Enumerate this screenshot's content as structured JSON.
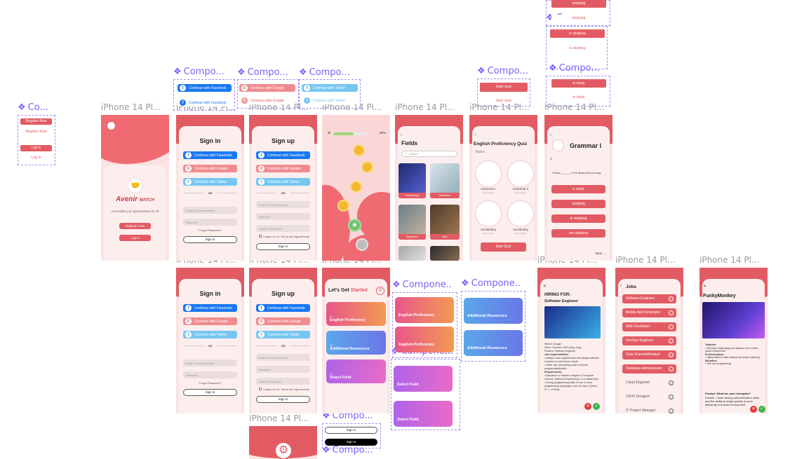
{
  "labels": {
    "iphone": "iPhone 14 Pl...",
    "component": "Compo...",
    "component_long": "Compone...",
    "co": "Co..."
  },
  "components": {
    "register_now": "Register Now",
    "log_in": "Log In",
    "continue_facebook": "Continue with Facebook",
    "continue_google": "Continue with Google",
    "continue_twitter": "Continue with Twitter",
    "start_quiz": "Start Quiz",
    "studying": "studying",
    "is_studying": "is studying",
    "is_study": "is study",
    "sign_in": "Sign in"
  },
  "landing": {
    "brand": "Avenir",
    "brand_suffix": "MATCH",
    "tagline": "Accessible job opportunities for all",
    "register_now": "Register Now",
    "log_in": "Log In"
  },
  "signin": {
    "title": "Sign in",
    "facebook": "Continue with Facebook",
    "google": "Continue with Google",
    "twitter": "Continue with Twitter",
    "or": "OR",
    "email_placeholder": "Email or mobile number",
    "password_placeholder": "Password",
    "forgot": "Forgot Password?",
    "submit": "Sign in"
  },
  "signup": {
    "title": "Sign up",
    "facebook": "Continue with Facebook",
    "google": "Continue with Google",
    "twitter": "Continue with Twitter",
    "or": "OR",
    "email_placeholder": "Email or mobile number",
    "password_placeholder": "Password",
    "confirm_placeholder": "Confirm Password",
    "terms": "I agree to our Terms and Agreements",
    "submit": "Sign in"
  },
  "progress": {
    "percent_label": "60%",
    "fill_fraction": 0.6
  },
  "fields": {
    "title": "Fields",
    "search_placeholder": "Search",
    "tiles": [
      "Technology",
      "Medicine",
      "Business",
      "Arts"
    ]
  },
  "english_quiz": {
    "title": "English Proficiency Quiz",
    "subtitle": "Topics",
    "topics": [
      {
        "name": "Grammar I",
        "sub": "10 questions"
      },
      {
        "name": "Grammar II",
        "sub": "10 questions"
      },
      {
        "name": "Vocabulary",
        "sub": "10 questions"
      },
      {
        "name": "Vocabulary",
        "sub": "10 questions"
      }
    ],
    "start": "Start Quiz"
  },
  "grammar": {
    "title": "Grammar I",
    "qnum": "1.",
    "question": "Prewa ______ in the library this morning.",
    "options": [
      "is study",
      "studying",
      "is studying",
      "am studying"
    ],
    "next": "Next →"
  },
  "started": {
    "title_a": "Let's Get",
    "title_b": "Started",
    "cards": [
      {
        "num": "01",
        "label": "English Proficiency"
      },
      {
        "num": "02",
        "label": "Additional Resources"
      },
      {
        "num": "03",
        "label": "Select Field"
      }
    ]
  },
  "comp_cards": {
    "english": "English Proficiency",
    "resources": "Additional Resources",
    "select": "Select Field"
  },
  "hiring": {
    "title": "HIRING FOR:",
    "role": "Software Engineer",
    "lines": [
      "Where: Google",
      "When: Summer 2023 (May–Aug)",
      "Position: Software Engineer",
      "Job responsibilities:",
      "Analyze user requirements and design software solutions to meet those needs",
      "Write, test, and debug code to ensure program/application",
      "Requirements:",
      "Bachelor's or Master's degree in Computer Science, Software Engineering, or a related field",
      "Strong programming skills in one or more programming languages, such as Java, Python, C++, or Ruby"
    ]
  },
  "jobs": {
    "title": "Jobs",
    "items": [
      {
        "name": "Software Engineer",
        "style": "red"
      },
      {
        "name": "Mobile App Developer",
        "style": "red"
      },
      {
        "name": "Web Developer",
        "style": "red"
      },
      {
        "name": "DevOps Engineer",
        "style": "red"
      },
      {
        "name": "Data Scientist/Analyst",
        "style": "red"
      },
      {
        "name": "Database Administrator",
        "style": "red"
      },
      {
        "name": "Cloud Engineer",
        "style": "plain"
      },
      {
        "name": "UI/UX Designer",
        "style": "plain"
      },
      {
        "name": "IT Project Manager",
        "style": "plain"
      }
    ]
  },
  "funky": {
    "title": "FunkyMonkey",
    "lines": [
      "Objective:",
      "Seeking a challenging and dynamic role in a fast-paced environment",
      "Professionalism:",
      "Highly skilled in data analysis and project planning",
      "Education:",
      "Tech and programming"
    ],
    "prompt": "Prompt: What are your strengths?",
    "answer": "Answer: I have strong communication skills, and the ability to adapt quickly to work efficiently in a team environment."
  },
  "colors": {
    "primary": "#e25b63",
    "accent": "#7b61ff",
    "facebook": "#1877f2",
    "twitter": "#76c6f2"
  }
}
